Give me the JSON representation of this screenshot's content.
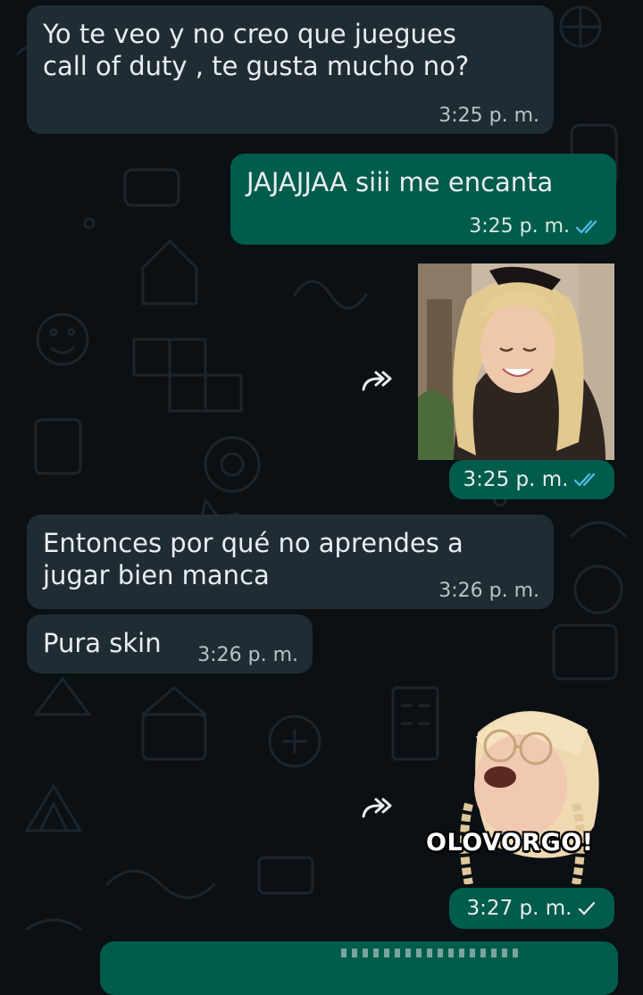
{
  "messages": [
    {
      "text": "Yo te veo y no creo que juegues\ncall of duty , te gusta mucho no?",
      "time": "3:25 p. m."
    },
    {
      "text": "JAJAJJAA siii me encanta",
      "time": "3:25 p. m."
    },
    {
      "time": "3:25 p. m."
    },
    {
      "text": "Entonces por qué no aprendes a\njugar bien manca",
      "time": "3:26 p. m."
    },
    {
      "text": "Pura skin",
      "time": "3:26 p. m."
    },
    {
      "sticker_caption": "OLOVORGO!",
      "time": "3:27 p. m."
    }
  ],
  "colors": {
    "background": "#0b1014",
    "incoming_bubble": "#202c33",
    "outgoing_bubble": "#005c4b",
    "read_ticks": "#53bdeb",
    "delivered_tick": "#e9edef"
  },
  "icons": {
    "read": "double-check-icon",
    "delivered": "single-check-icon",
    "forward": "forward-icon"
  }
}
